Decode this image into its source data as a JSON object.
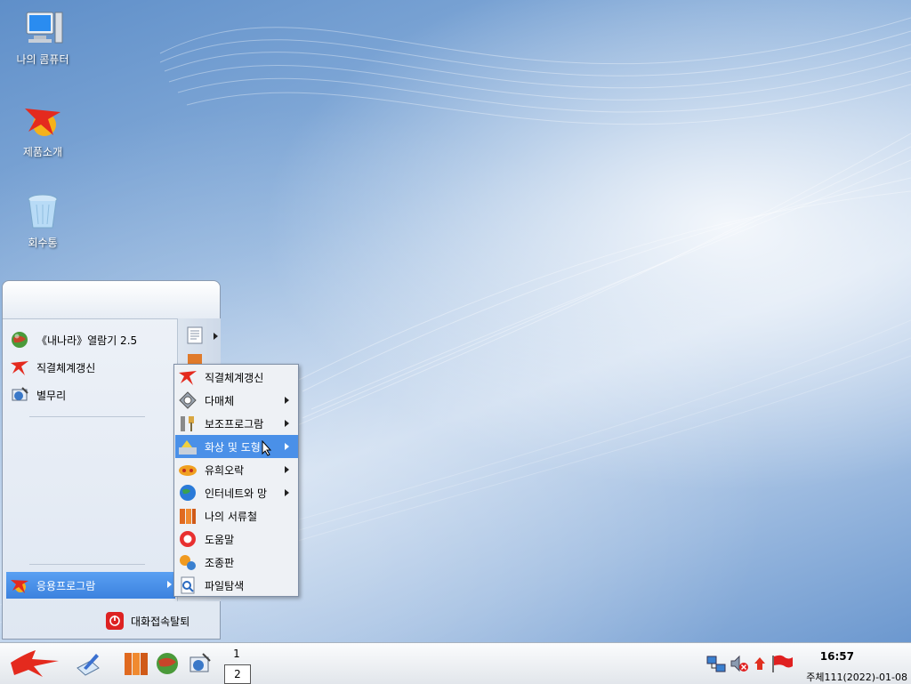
{
  "desktop": {
    "icons": [
      {
        "label": "나의 콤퓨터",
        "icon": "computer-icon"
      },
      {
        "label": "제품소개",
        "icon": "redstar-logo-icon"
      },
      {
        "label": "회수통",
        "icon": "trash-icon"
      }
    ]
  },
  "start_menu": {
    "favorites": [
      {
        "label": "《내나라》열람기 2.5",
        "icon": "globe-icon"
      },
      {
        "label": "직결체계갱신",
        "icon": "redstar-icon"
      },
      {
        "label": "별무리",
        "icon": "mail-icon"
      }
    ],
    "apps_label": "응용프로그람",
    "logout_label": "대화접속탈퇴"
  },
  "submenu": {
    "items": [
      {
        "label": "직결체계갱신",
        "icon": "redstar-icon",
        "has_sub": false
      },
      {
        "label": "다매체",
        "icon": "multimedia-icon",
        "has_sub": true
      },
      {
        "label": "보조프로그람",
        "icon": "tools-icon",
        "has_sub": true
      },
      {
        "label": "화상 및 도형",
        "icon": "graphics-icon",
        "has_sub": true,
        "active": true
      },
      {
        "label": "유희오락",
        "icon": "games-icon",
        "has_sub": true
      },
      {
        "label": "인터네트와 망",
        "icon": "globe-icon",
        "has_sub": true
      },
      {
        "label": "나의 서류철",
        "icon": "folder-icon",
        "has_sub": false
      },
      {
        "label": "도움말",
        "icon": "help-icon",
        "has_sub": false
      },
      {
        "label": "조종판",
        "icon": "control-panel-icon",
        "has_sub": false
      },
      {
        "label": "파일탐색",
        "icon": "file-search-icon",
        "has_sub": false
      }
    ]
  },
  "taskbar": {
    "workspaces": [
      "1",
      "2"
    ],
    "clock": "16:57",
    "date": "주체111(2022)-01-08"
  },
  "colors": {
    "highlight": "#4a90e8",
    "desktop": "#8eb2dc"
  }
}
